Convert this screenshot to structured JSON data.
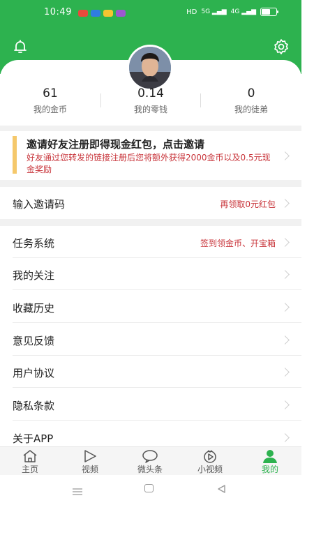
{
  "status_bar": {
    "time": "10:49",
    "network_label": "HD",
    "signal_1": "5G",
    "signal_2": "4G",
    "battery_level": 0.6
  },
  "profile": {
    "stats": [
      {
        "value": "61",
        "label": "我的金币"
      },
      {
        "value": "0.14",
        "label": "我的零钱"
      },
      {
        "value": "0",
        "label": "我的徒弟"
      }
    ]
  },
  "invite_banner": {
    "title": "邀请好友注册即得现金红包，点击邀请",
    "subtitle": "好友通过您转发的链接注册后您将额外获得2000金币以及0.5元现金奖励"
  },
  "invite_code_row": {
    "label": "输入邀请码",
    "extra": "再领取0元红包"
  },
  "menu": [
    {
      "label": "任务系统",
      "extra": "签到领金币、开宝箱"
    },
    {
      "label": "我的关注",
      "extra": ""
    },
    {
      "label": "收藏历史",
      "extra": ""
    },
    {
      "label": "意见反馈",
      "extra": ""
    },
    {
      "label": "用户协议",
      "extra": ""
    },
    {
      "label": "隐私条款",
      "extra": ""
    },
    {
      "label": "关于APP",
      "extra": ""
    }
  ],
  "tabs": [
    {
      "label": "主页",
      "icon": "home-icon"
    },
    {
      "label": "视频",
      "icon": "play-icon"
    },
    {
      "label": "微头条",
      "icon": "chat-bubble-icon"
    },
    {
      "label": "小视频",
      "icon": "small-video-icon"
    },
    {
      "label": "我的",
      "icon": "user-icon",
      "active": true
    }
  ],
  "colors": {
    "brand_green": "#2db24f",
    "accent_red": "#c8343a",
    "invite_bar": "#f5c86b"
  }
}
